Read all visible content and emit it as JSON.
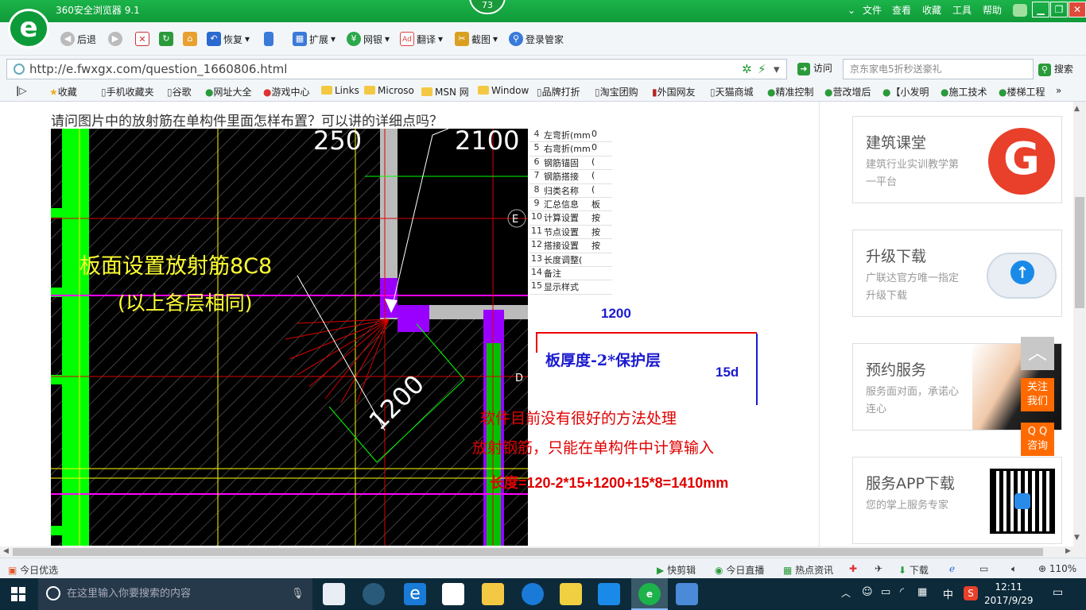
{
  "window": {
    "title": "360安全浏览器 9.1",
    "badge": "73",
    "menu": [
      "文件",
      "查看",
      "收藏",
      "工具",
      "帮助"
    ]
  },
  "toolbar": {
    "back": "后退",
    "restore": "恢复",
    "extend": "扩展",
    "bank": "网银",
    "translate": "翻译",
    "screenshot": "截图",
    "login": "登录管家"
  },
  "address": {
    "url": "http://e.fwxgx.com/question_1660806.html",
    "visit": "访问",
    "search_placeholder": "京东家电5折秒送豪礼",
    "search_btn": "搜索"
  },
  "bookmarks": [
    "收藏",
    "手机收藏夹",
    "谷歌",
    "网址大全",
    "游戏中心",
    "Links",
    "Microso",
    "MSN 网",
    "Window",
    "品牌打折",
    "淘宝团购",
    "外国网友",
    "天猫商城",
    "精准控制",
    "营改增后",
    "【小发明",
    "施工技术",
    "楼梯工程"
  ],
  "page": {
    "question": "请问图片中的放射筋在单构件里面怎样布置？可以讲的详细点吗？",
    "cad": {
      "label1": "板面设置放射筋8C8",
      "label2": "(以上各层相同)",
      "dim_250": "250",
      "dim_2100": "2100",
      "dim_1200_diag": "1200",
      "axis_e": "E",
      "axis_d": "D"
    },
    "props": [
      [
        "4",
        "左弯折(mm",
        "0"
      ],
      [
        "5",
        "右弯折(mm",
        "0"
      ],
      [
        "6",
        "钢筋锚固",
        "("
      ],
      [
        "7",
        "钢筋搭接",
        "("
      ],
      [
        "8",
        "归类名称",
        "("
      ],
      [
        "9",
        "汇总信息",
        "板"
      ],
      [
        "10",
        "计算设置",
        "按"
      ],
      [
        "11",
        "节点设置",
        "按"
      ],
      [
        "12",
        "搭接设置",
        "按"
      ],
      [
        "13",
        "长度调整(",
        ""
      ],
      [
        "14",
        "备注",
        ""
      ],
      [
        "15",
        "显示样式",
        ""
      ]
    ],
    "annot": {
      "dim": "1200",
      "thickness": "板厚度-2*保护层",
      "d15": "15d",
      "note1": "软件目前没有很好的方法处理",
      "note2": "放射钢筋，只能在单构件中计算输入",
      "formula": "长度=120-2*15+1200+15*8=1410mm"
    }
  },
  "sidebar": [
    {
      "title": "建筑课堂",
      "sub": "建筑行业实训教学第一平台"
    },
    {
      "title": "升级下载",
      "sub": "广联达官方唯一指定升级下载"
    },
    {
      "title": "预约服务",
      "sub": "服务面对面，承诺心连心"
    },
    {
      "title": "服务APP下载",
      "sub": "您的掌上服务专家"
    }
  ],
  "float": {
    "follow": "关注\n我们",
    "qq": "Q Q\n咨询"
  },
  "status": {
    "today": "今日优选",
    "clip": "快剪辑",
    "live": "今日直播",
    "hot": "热点资讯",
    "download": "下载",
    "zoom": "110%"
  },
  "taskbar": {
    "search_placeholder": "在这里输入你要搜索的内容",
    "time": "12:11",
    "date": "2017/9/29",
    "ime": "中"
  },
  "colors": {
    "brand": "#1cb34a",
    "cad_green": "#00ff00",
    "cad_magenta": "#ff00ff",
    "annot_red": "#e00000",
    "annot_blue": "#1a1ad0",
    "orange": "#ff6a00"
  }
}
